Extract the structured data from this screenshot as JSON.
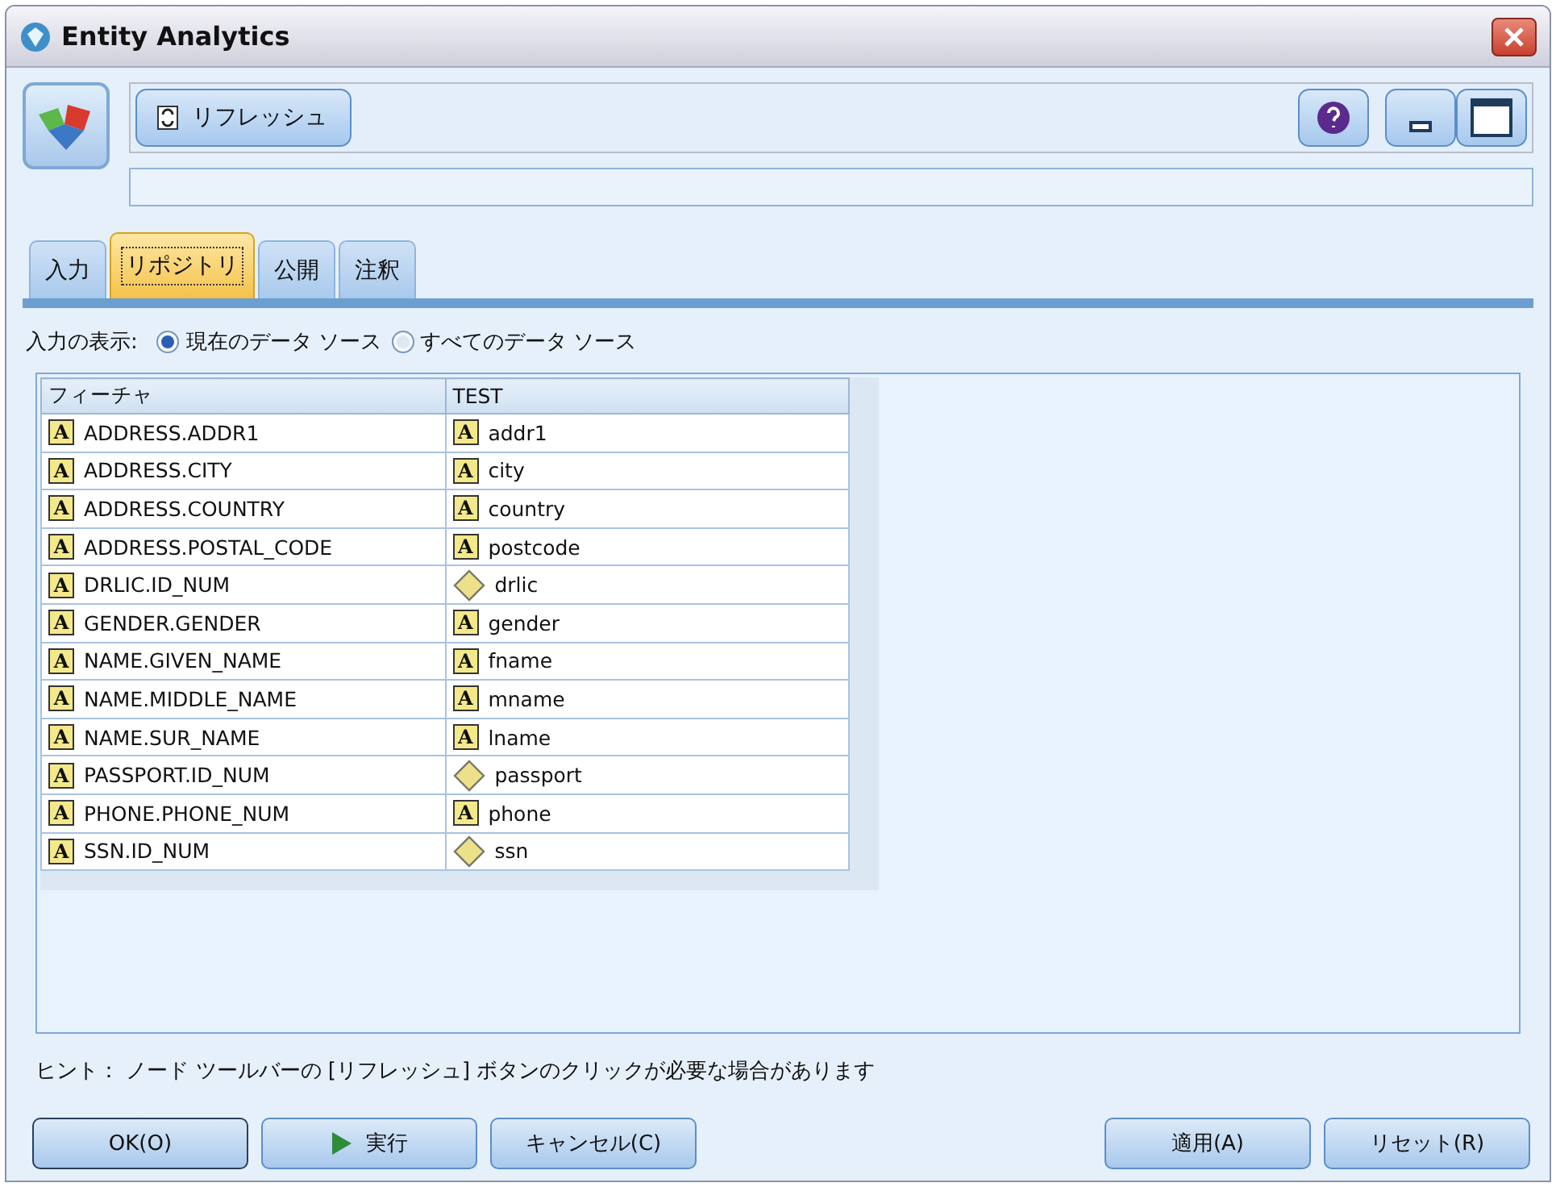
{
  "window": {
    "title": "Entity Analytics"
  },
  "toolbar": {
    "refresh_button": "リフレッシュ"
  },
  "tabs": [
    {
      "label": "入力",
      "selected": false
    },
    {
      "label": "リポジトリ",
      "selected": true
    },
    {
      "label": "公開",
      "selected": false
    },
    {
      "label": "注釈",
      "selected": false
    }
  ],
  "input_display": {
    "label": "入力の表示:",
    "options": [
      {
        "label": "現在のデータ ソース",
        "selected": true
      },
      {
        "label": "すべてのデータ ソース",
        "selected": false
      }
    ]
  },
  "table": {
    "columns": [
      "フィーチャ",
      "TEST"
    ],
    "rows": [
      [
        {
          "text": "ADDRESS.ADDR1",
          "kind": "string",
          "glyph": "A"
        },
        {
          "text": "addr1",
          "kind": "string",
          "glyph": "A"
        }
      ],
      [
        {
          "text": "ADDRESS.CITY",
          "kind": "string",
          "glyph": "A"
        },
        {
          "text": "city",
          "kind": "string",
          "glyph": "A"
        }
      ],
      [
        {
          "text": "ADDRESS.COUNTRY",
          "kind": "string",
          "glyph": "A"
        },
        {
          "text": "country",
          "kind": "string",
          "glyph": "A"
        }
      ],
      [
        {
          "text": "ADDRESS.POSTAL_CODE",
          "kind": "string",
          "glyph": "A"
        },
        {
          "text": "postcode",
          "kind": "string",
          "glyph": "A"
        }
      ],
      [
        {
          "text": "DRLIC.ID_NUM",
          "kind": "string",
          "glyph": "A"
        },
        {
          "text": "drlic",
          "kind": "nominal"
        }
      ],
      [
        {
          "text": "GENDER.GENDER",
          "kind": "string",
          "glyph": "A"
        },
        {
          "text": "gender",
          "kind": "string",
          "glyph": "A"
        }
      ],
      [
        {
          "text": "NAME.GIVEN_NAME",
          "kind": "string",
          "glyph": "A"
        },
        {
          "text": "fname",
          "kind": "string",
          "glyph": "A"
        }
      ],
      [
        {
          "text": "NAME.MIDDLE_NAME",
          "kind": "string",
          "glyph": "A"
        },
        {
          "text": "mname",
          "kind": "string",
          "glyph": "A"
        }
      ],
      [
        {
          "text": "NAME.SUR_NAME",
          "kind": "string",
          "glyph": "A"
        },
        {
          "text": "lname",
          "kind": "string",
          "glyph": "A"
        }
      ],
      [
        {
          "text": "PASSPORT.ID_NUM",
          "kind": "string",
          "glyph": "A"
        },
        {
          "text": "passport",
          "kind": "nominal"
        }
      ],
      [
        {
          "text": "PHONE.PHONE_NUM",
          "kind": "string",
          "glyph": "A"
        },
        {
          "text": "phone",
          "kind": "string",
          "glyph": "A"
        }
      ],
      [
        {
          "text": "SSN.ID_NUM",
          "kind": "string",
          "glyph": "A"
        },
        {
          "text": "ssn",
          "kind": "nominal"
        }
      ]
    ]
  },
  "hint": "ヒント： ノード ツールバーの [リフレッシュ] ボタンのクリックが必要な場合があります",
  "buttons_left": [
    {
      "label": "OK(O)",
      "kind": "default"
    },
    {
      "label": "実行",
      "kind": "run"
    },
    {
      "label": "キャンセル(C)",
      "kind": "plain"
    }
  ],
  "buttons_right": [
    "適用(A)",
    "リセット(R)"
  ]
}
